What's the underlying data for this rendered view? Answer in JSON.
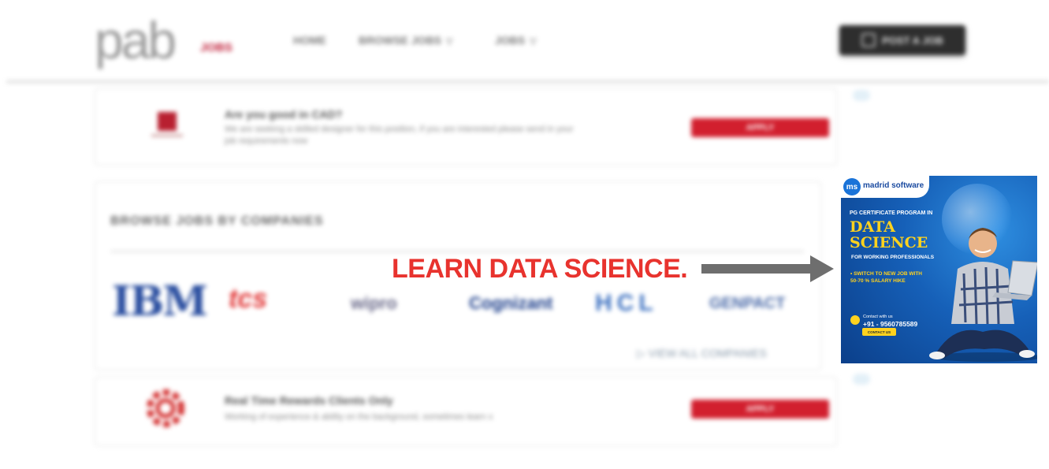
{
  "header": {
    "logo_text": "pab",
    "logo_sub": "JOBS",
    "nav": [
      {
        "label": "HOME",
        "has_caret": false
      },
      {
        "label": "BROWSE JOBS",
        "has_caret": true
      },
      {
        "label": "JOBS",
        "has_caret": true
      }
    ],
    "cta_label": "POST A JOB"
  },
  "jobs": [
    {
      "title": "Are you good in CAD?",
      "desc_line1": "We are seeking a skilled designer for this position, if you are interested please send in your",
      "desc_line2": "job requirements now",
      "apply_label": "APPLY"
    },
    {
      "title": "Real Time Rewards Clients Only",
      "desc_line1": "Working of experience & ability on the background, sometimes learn x",
      "desc_line2": "",
      "apply_label": "APPLY"
    }
  ],
  "companies_section": {
    "title": "BROWSE JOBS BY COMPANIES",
    "companies": [
      "IBM",
      "tcs",
      "wipro",
      "Cognizant",
      "HCL",
      "GENPACT"
    ],
    "view_all": "VIEW ALL COMPANIES"
  },
  "overlay": {
    "caption": "LEARN DATA SCIENCE."
  },
  "ad": {
    "brand_mark": "ms",
    "brand": "madrid software",
    "program": "PG CERTIFICATE PROGRAM IN",
    "headline_1": "DATA",
    "headline_2": "SCIENCE",
    "audience": "FOR WORKING PROFESSIONALS",
    "bullet_1": "• SWITCH TO NEW JOB WITH",
    "bullet_2": "50-70 % SALARY HIKE",
    "contact_label": "Contact with us",
    "phone": "+91 - 9560785589",
    "contact_button": "CONTACT US"
  },
  "colors": {
    "accent_red": "#d21f2e",
    "overlay_red": "#e8332e",
    "ad_yellow": "#ffd21e",
    "ad_blue": "#1660b8"
  }
}
